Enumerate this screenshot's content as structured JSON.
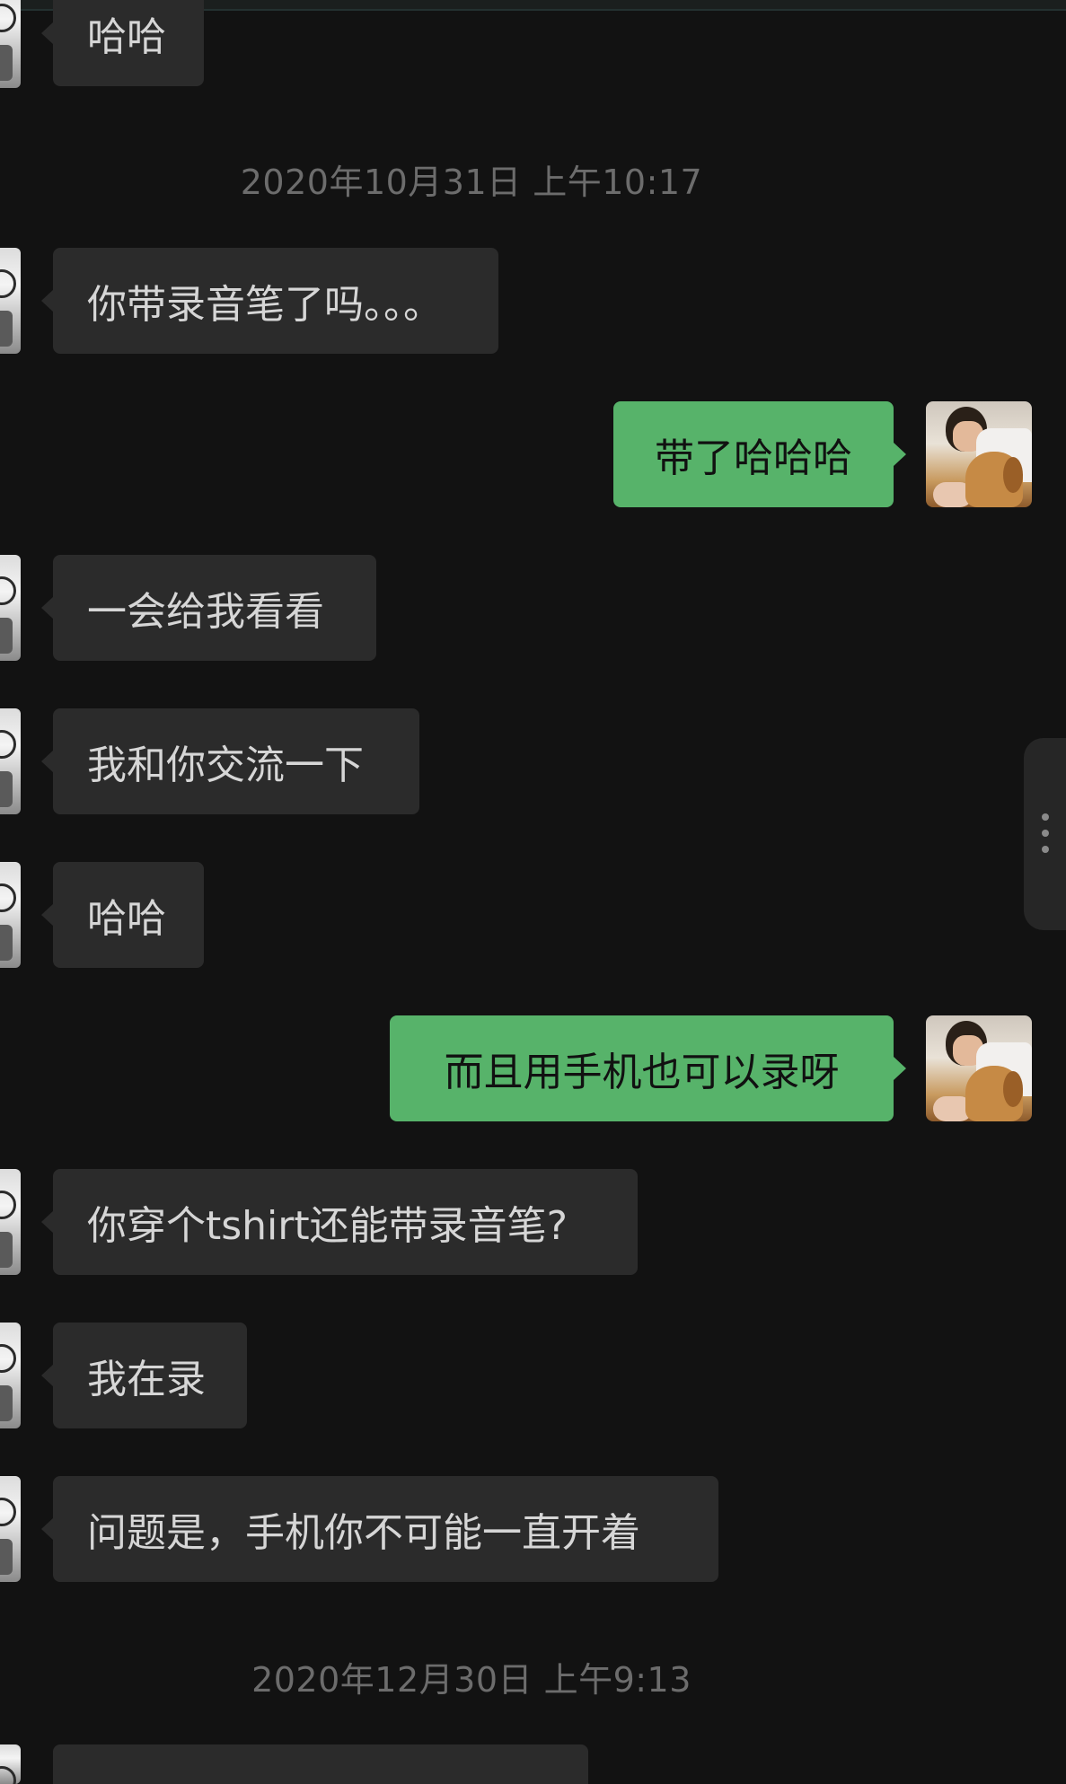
{
  "chat": {
    "timestamps": [
      "2020年10月31日 上午10:17",
      "2020年12月30日 上午9:13"
    ],
    "messages": [
      {
        "side": "in",
        "text": "哈哈"
      },
      {
        "side": "in",
        "text": "你带录音笔了吗。。。"
      },
      {
        "side": "out",
        "text": "带了哈哈哈"
      },
      {
        "side": "in",
        "text": "一会给我看看"
      },
      {
        "side": "in",
        "text": "我和你交流一下"
      },
      {
        "side": "in",
        "text": "哈哈"
      },
      {
        "side": "out",
        "text": "而且用手机也可以录呀"
      },
      {
        "side": "in",
        "text": "你穿个tshirt还能带录音笔?"
      },
      {
        "side": "in",
        "text": "我在录"
      },
      {
        "side": "in",
        "text": "问题是，手机你不可能一直开着"
      },
      {
        "side": "in",
        "text": "⋯⋯⋯⋯⋯⋯⋯"
      }
    ]
  },
  "colors": {
    "background": "#121212",
    "incoming_bubble": "#2b2b2b",
    "outgoing_bubble": "#57b36a",
    "timestamp_text": "#6c6c6c"
  },
  "icons": {
    "more": "vertical-dots-icon"
  }
}
